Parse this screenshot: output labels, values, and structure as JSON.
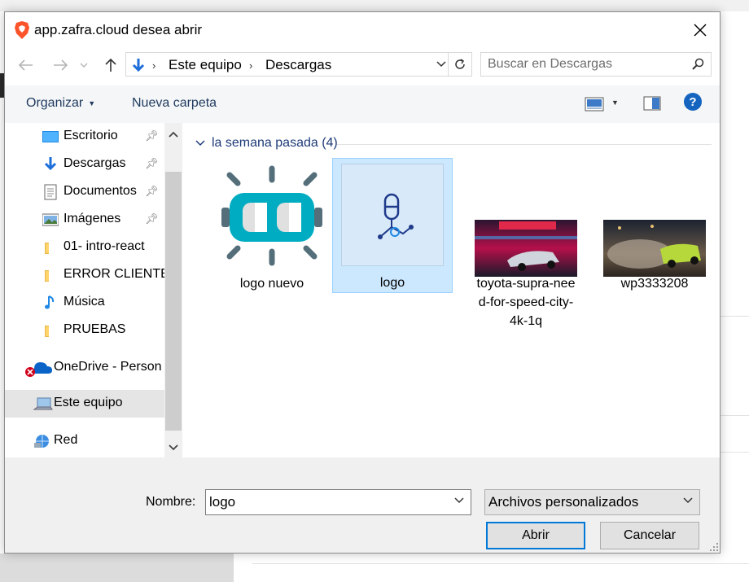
{
  "dialog": {
    "title": "app.zafra.cloud desea abrir"
  },
  "address": {
    "segments": [
      "Este equipo",
      "Descargas"
    ]
  },
  "search": {
    "placeholder": "Buscar en Descargas"
  },
  "toolbar": {
    "organize_label": "Organizar",
    "new_folder_label": "Nueva carpeta"
  },
  "sidebar": {
    "items": [
      {
        "label": "Escritorio",
        "icon": "desktop-icon",
        "pinned": true
      },
      {
        "label": "Descargas",
        "icon": "download-icon",
        "pinned": true
      },
      {
        "label": "Documentos",
        "icon": "document-icon",
        "pinned": true
      },
      {
        "label": "Imágenes",
        "icon": "pictures-icon",
        "pinned": true
      },
      {
        "label": "01- intro-react",
        "icon": "folder-icon",
        "pinned": false
      },
      {
        "label": "ERROR CLIENTE",
        "icon": "folder-icon",
        "pinned": false
      },
      {
        "label": "Música",
        "icon": "music-icon",
        "pinned": false
      },
      {
        "label": "PRUEBAS",
        "icon": "folder-icon",
        "pinned": false
      },
      {
        "label": "OneDrive - Person",
        "icon": "onedrive-icon",
        "pinned": false
      },
      {
        "label": "Este equipo",
        "icon": "this-pc-icon",
        "selected": true
      },
      {
        "label": "Red",
        "icon": "network-icon",
        "pinned": false
      }
    ]
  },
  "content": {
    "group_label": "la semana pasada (4)",
    "files": [
      {
        "name": "logo nuevo",
        "selected": false
      },
      {
        "name": "logo",
        "selected": true
      },
      {
        "name": "toyota-supra-need-for-speed-city-4k-1q",
        "name_lines": [
          "toyota-supra-nee",
          "d-for-speed-city-",
          "4k-1q"
        ],
        "selected": false
      },
      {
        "name": "wp3333208",
        "selected": false
      }
    ]
  },
  "footer": {
    "name_label": "Nombre:",
    "name_value": "logo",
    "filter_value": "Archivos personalizados",
    "open_label": "Abrir",
    "cancel_label": "Cancelar"
  },
  "colors": {
    "accent": "#0078d7",
    "selection": "#cce8ff",
    "brave": "#fb542b"
  }
}
